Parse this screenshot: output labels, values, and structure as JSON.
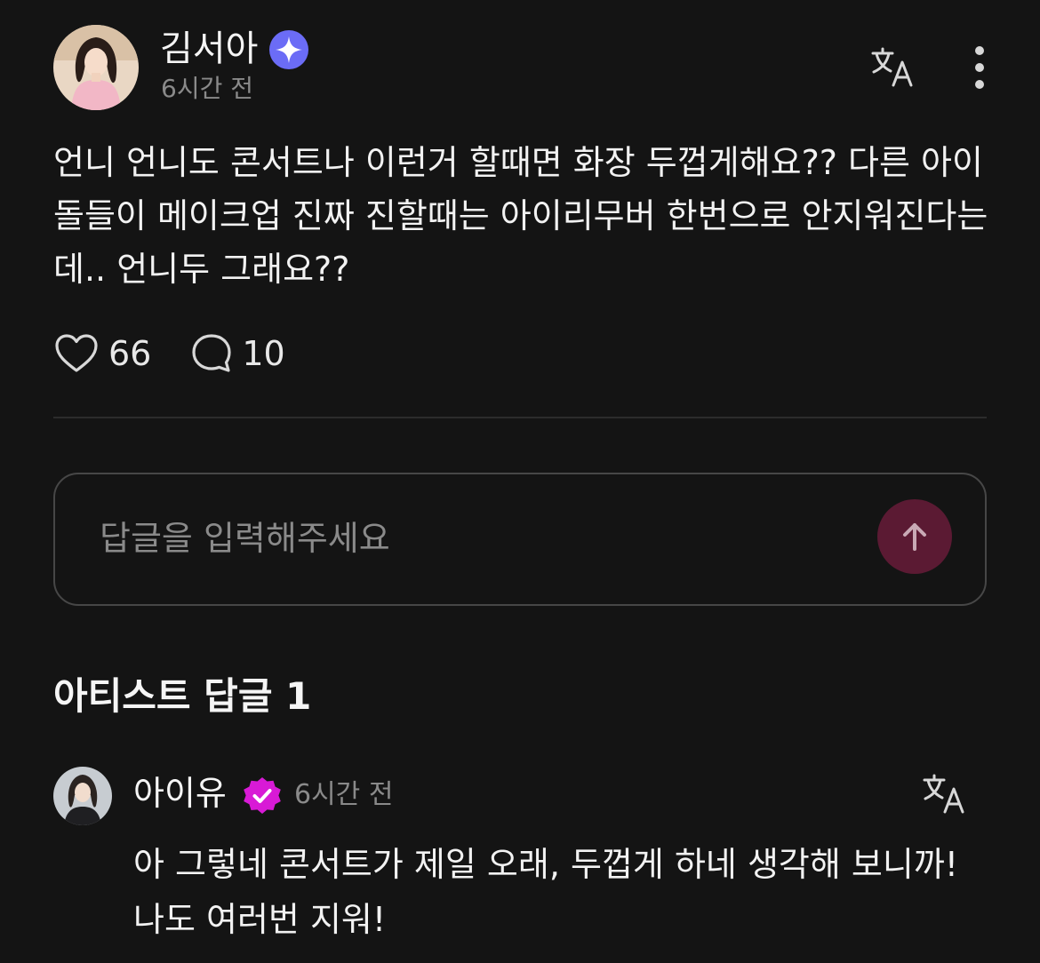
{
  "post": {
    "author": "김서아",
    "time": "6시간 전",
    "body": "언니 언니도 콘서트나 이런거 할때면 화장 두껍게해요?? 다른 아이돌들이 메이크업 진짜 진할때는 아이리무버 한번으로 안지워진다는데.. 언니두 그래요??",
    "likes": "66",
    "comments": "10",
    "icons": {
      "badge": "sparkle-badge-icon",
      "translate": "translate-icon",
      "more": "more-vertical-icon",
      "like": "heart-icon",
      "comment": "comment-bubble-icon"
    }
  },
  "reply_input": {
    "placeholder": "답글을 입력해주세요",
    "value": "",
    "send_icon": "arrow-up-icon"
  },
  "artist_replies": {
    "heading": "아티스트 답글 1",
    "items": [
      {
        "author": "아이유",
        "time": "6시간 전",
        "text": "아 그렇네 콘서트가 제일 오래, 두껍게 하네 생각해 보니까! 나도 여러번 지워!",
        "badge_icon": "verified-check-badge-icon"
      }
    ]
  },
  "colors": {
    "background": "#141414",
    "divider": "#2c2c2c",
    "secondary_text": "#8a8a8a",
    "sparkle_badge": "#6b6cf6",
    "verified_badge": "#d81ad6",
    "send_button": "#5b1a33"
  }
}
